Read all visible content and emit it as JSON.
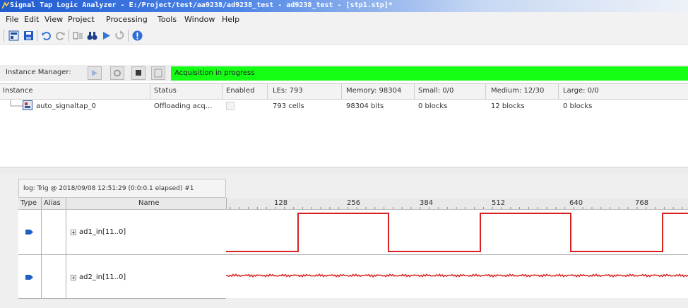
{
  "window": {
    "title": "Signal Tap Logic Analyzer - E:/Project/test/aa9238/ad9238_test - ad9238_test - [stp1.stp]*"
  },
  "menu": [
    {
      "label": "File"
    },
    {
      "label": "Edit"
    },
    {
      "label": "View"
    },
    {
      "label": "Project"
    },
    {
      "label": "Processing"
    },
    {
      "label": "Tools"
    },
    {
      "label": "Window"
    },
    {
      "label": "Help"
    }
  ],
  "instance_manager": {
    "label": "Instance Manager:",
    "status": "Acquisition in progress",
    "status_color": "#15ff15"
  },
  "instance_table": {
    "headers": {
      "instance": "Instance",
      "status": "Status",
      "enabled": "Enabled",
      "les": "LEs: 793",
      "memory": "Memory: 98304",
      "small": "Small: 0/0",
      "medium": "Medium: 12/30",
      "large": "Large: 0/0"
    },
    "row": {
      "instance": "auto_signaltap_0",
      "status": "Offloading acq...",
      "les": "793 cells",
      "memory": "98304 bits",
      "small": "0 blocks",
      "medium": "12 blocks",
      "large": "0 blocks"
    }
  },
  "waveform": {
    "tab": "log: Trig @ 2018/09/08 12:51:29 (0:0:0.1 elapsed) #1",
    "headers": {
      "type": "Type",
      "alias": "Alias",
      "name": "Name"
    },
    "ticks": [
      "128",
      "256",
      "384",
      "512",
      "640",
      "768"
    ],
    "signals": [
      {
        "name": "ad1_in[11..0]"
      },
      {
        "name": "ad2_in[11..0]"
      }
    ],
    "wave_color": "#d92020"
  }
}
